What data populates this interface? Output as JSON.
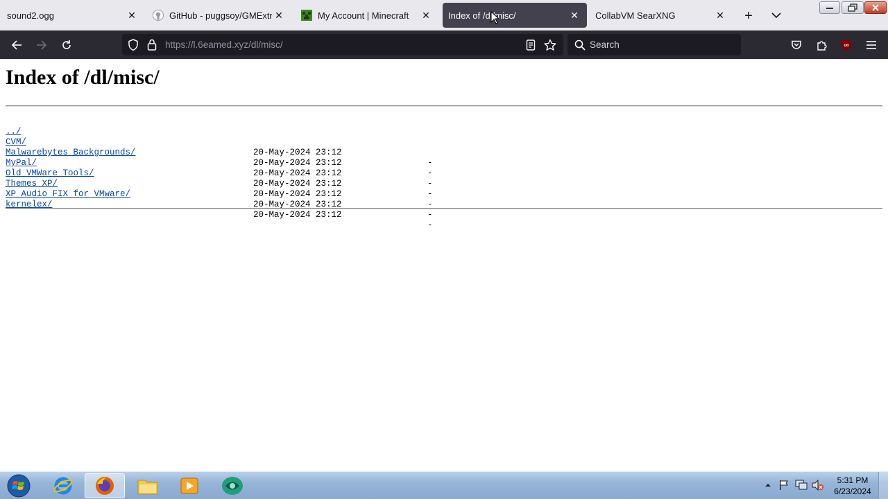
{
  "browser": {
    "tabs": [
      {
        "title": "sound2.ogg",
        "active": false,
        "icon": "none"
      },
      {
        "title": "GitHub - puggsoy/GMExtract",
        "active": false,
        "icon": "github-icon"
      },
      {
        "title": "My Account | Minecraft",
        "active": false,
        "icon": "minecraft-icon"
      },
      {
        "title": "Index of /dl/misc/",
        "active": true,
        "icon": "none"
      },
      {
        "title": "CollabVM SearXNG",
        "active": false,
        "icon": "none"
      }
    ],
    "url_host": "https://l.6eamed.xyz",
    "url_path": "/dl/misc/",
    "search_placeholder": "Search"
  },
  "page": {
    "heading": "Index of /dl/misc/",
    "parent_link": "../",
    "entries": [
      {
        "name": "CVM/",
        "date": "20-May-2024 23:12",
        "size": "-"
      },
      {
        "name": "Malwarebytes Backgrounds/",
        "date": "20-May-2024 23:12",
        "size": "-"
      },
      {
        "name": "MyPal/",
        "date": "20-May-2024 23:12",
        "size": "-"
      },
      {
        "name": "Old VMWare Tools/",
        "date": "20-May-2024 23:12",
        "size": "-"
      },
      {
        "name": "Themes XP/",
        "date": "20-May-2024 23:12",
        "size": "-"
      },
      {
        "name": "XP Audio FIX for VMware/",
        "date": "20-May-2024 23:12",
        "size": "-"
      },
      {
        "name": "kernelex/",
        "date": "20-May-2024 23:12",
        "size": "-"
      }
    ]
  },
  "taskbar": {
    "time": "5:31 PM",
    "date": "6/23/2024"
  },
  "colors": {
    "link": "#0645ad",
    "active_tab": "#42414d",
    "toolbar": "#2b2a33"
  }
}
